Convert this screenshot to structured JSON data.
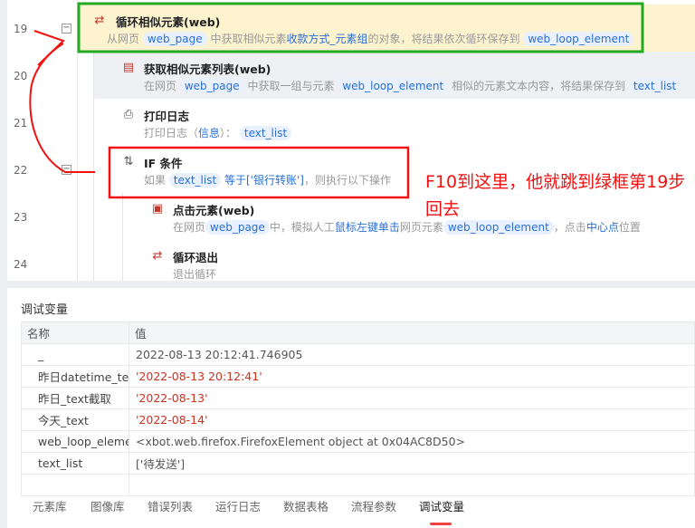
{
  "flow": {
    "rows": [
      {
        "line": "19",
        "icon": "loop-icon",
        "title": "循环相似元素(web)",
        "desc": [
          "从网页",
          "web_page",
          "中获取相似元素",
          "收款方式_元素组",
          "的对象，将结果依次循环保存到",
          "web_loop_element"
        ]
      },
      {
        "line": "20",
        "icon": "element-list-icon",
        "title": "获取相似元素列表(web)",
        "desc": [
          "在网页",
          "web_page",
          "中获取一组与元素",
          "web_loop_element",
          "相似的元素文本内容，将结果保存到",
          "text_list"
        ]
      },
      {
        "line": "21",
        "icon": "printer-icon",
        "title": "打印日志",
        "desc": [
          "打印日志（",
          "信息",
          "）：",
          "text_list"
        ]
      },
      {
        "line": "22",
        "icon": "if-icon",
        "title": "IF 条件",
        "desc": [
          "如果",
          "text_list",
          "等于['银行转账']",
          "，则执行以下操作"
        ]
      },
      {
        "line": "23",
        "icon": "click-icon",
        "title": "点击元素(web)",
        "desc": [
          "在网页",
          "web_page",
          "中，模拟人工",
          "鼠标左键单击",
          "网页元素",
          "web_loop_element",
          "，点击",
          "中心点",
          "位置"
        ]
      },
      {
        "line": "24",
        "icon": "loop-exit-icon",
        "title": "循环退出",
        "desc": [
          "退出循环"
        ]
      }
    ]
  },
  "annotation": {
    "text": "F10到这里，他就跳到绿框第19步回去",
    "color": "#f01010"
  },
  "panel": {
    "title": "调试变量",
    "columns": [
      "名称",
      "值"
    ],
    "rows": [
      {
        "name": "_",
        "value": "2022-08-13 20:12:41.746905",
        "red": false
      },
      {
        "name": "昨日datetime_text",
        "value": "'2022-08-13 20:12:41'",
        "red": true
      },
      {
        "name": "昨日_text截取",
        "value": "'2022-08-13'",
        "red": true
      },
      {
        "name": "今天_text",
        "value": "'2022-08-14'",
        "red": true
      },
      {
        "name": "web_loop_element",
        "value": "<xbot.web.firefox.FirefoxElement object at 0x04AC8D50>",
        "red": false
      },
      {
        "name": "text_list",
        "value": "['待发送']",
        "red": false
      }
    ],
    "tabs": [
      "元素库",
      "图像库",
      "错误列表",
      "运行日志",
      "数据表格",
      "流程参数",
      "调试变量"
    ],
    "active_tab": "调试变量"
  }
}
